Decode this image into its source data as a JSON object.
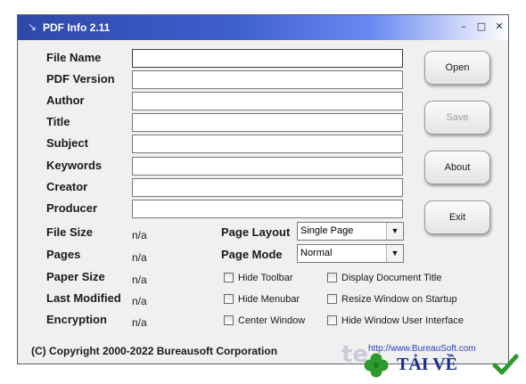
{
  "window": {
    "title": "PDF Info 2.11",
    "controls": {
      "minimize": "–",
      "maximize": "□",
      "close": "✕"
    }
  },
  "fields": [
    {
      "label": "File Name",
      "value": ""
    },
    {
      "label": "PDF Version",
      "value": ""
    },
    {
      "label": "Author",
      "value": ""
    },
    {
      "label": "Title",
      "value": ""
    },
    {
      "label": "Subject",
      "value": ""
    },
    {
      "label": "Keywords",
      "value": ""
    },
    {
      "label": "Creator",
      "value": ""
    },
    {
      "label": "Producer",
      "value": ""
    }
  ],
  "info": [
    {
      "label": "File Size",
      "value": "n/a"
    },
    {
      "label": "Pages",
      "value": "n/a"
    },
    {
      "label": "Paper Size",
      "value": "n/a"
    },
    {
      "label": "Last Modified",
      "value": "n/a"
    },
    {
      "label": "Encryption",
      "value": "n/a"
    }
  ],
  "buttons": {
    "open": "Open",
    "save": "Save",
    "about": "About",
    "exit": "Exit"
  },
  "page_layout": {
    "label": "Page Layout",
    "selected": "Single Page"
  },
  "page_mode": {
    "label": "Page Mode",
    "selected": "Normal"
  },
  "checkboxes": [
    {
      "label": "Hide Toolbar",
      "checked": false
    },
    {
      "label": "Display Document Title",
      "checked": false
    },
    {
      "label": "Hide Menubar",
      "checked": false
    },
    {
      "label": "Resize Window on Startup",
      "checked": false
    },
    {
      "label": "Center Window",
      "checked": false
    },
    {
      "label": "Hide Window User Interface",
      "checked": false
    }
  ],
  "footer": {
    "copyright": "(C) Copyright 2000-2022 Bureausoft Corporation",
    "link": "http://www.BureauSoft.com"
  },
  "watermark": {
    "prefix": "te",
    "text": "TẢI VỀ",
    "colors": {
      "text": "#1a2f8c",
      "clover": "#2e9a2e",
      "check": "#2e9a2e"
    }
  },
  "colors": {
    "titlebar_start": "#2f48a8",
    "titlebar_end": "#ffffff",
    "window_bg": "#f0f0f0",
    "link": "#2b3fb8"
  }
}
